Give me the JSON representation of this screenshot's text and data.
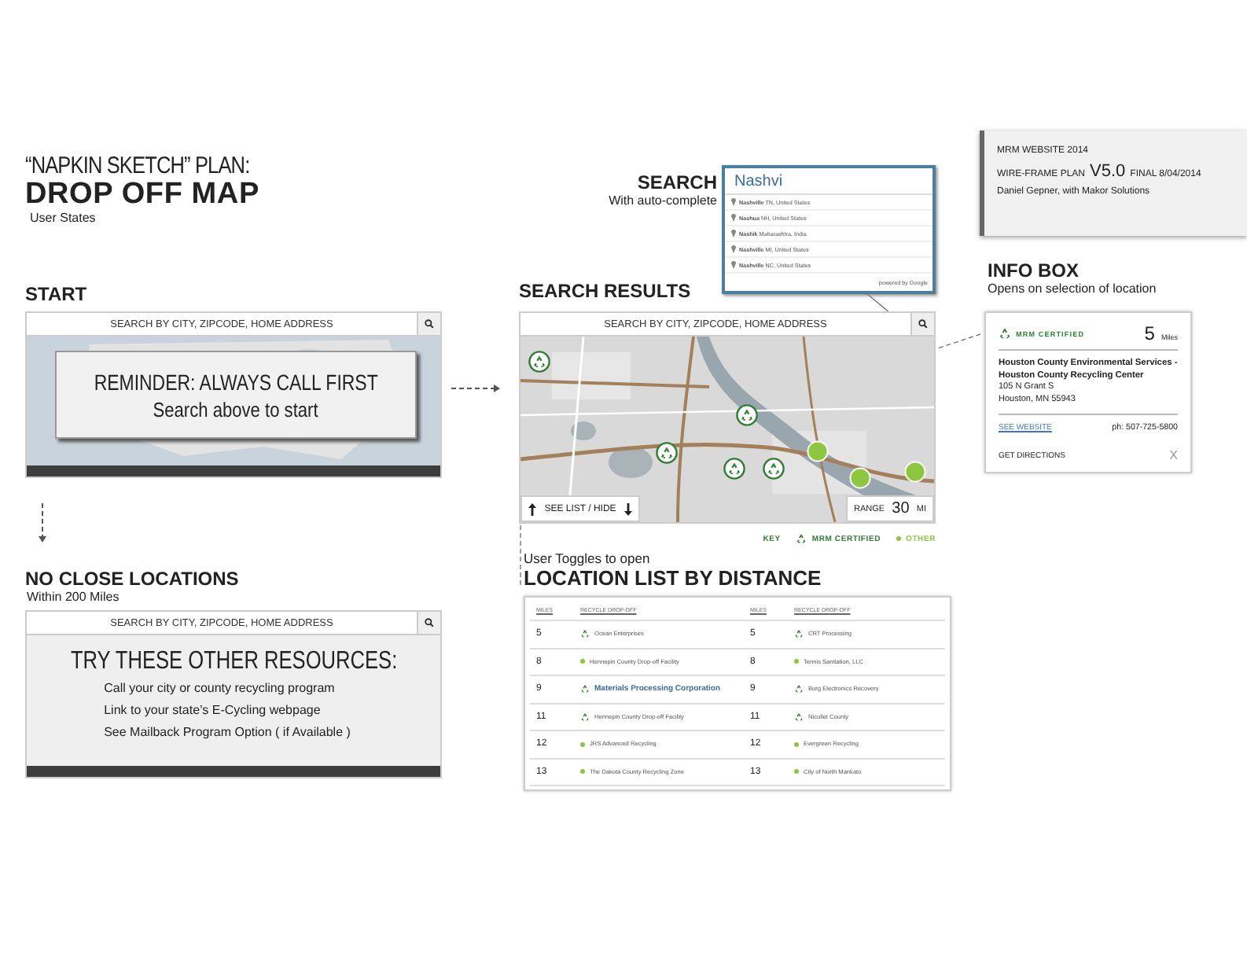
{
  "header": {
    "overline": "“NAPKIN SKETCH” PLAN:",
    "title": "DROP OFF MAP",
    "subtitle": "User States"
  },
  "version_box": {
    "line_1": "MRM WEBSITE 2014",
    "plan_label": "WIRE-FRAME PLAN",
    "version": "V5.0",
    "final": "FINAL 8/04/2014",
    "author": "Daniel Gepner, with Makor Solutions"
  },
  "start": {
    "heading": "START",
    "search_placeholder": "SEARCH BY CITY, ZIPCODE, HOME ADDRESS",
    "reminder_title": "REMINDER: ALWAYS CALL FIRST",
    "reminder_text": "Search above to start"
  },
  "no_close": {
    "heading": "NO CLOSE LOCATIONS",
    "subheading": "Within 200 Miles",
    "search_placeholder": "SEARCH BY CITY, ZIPCODE, HOME ADDRESS",
    "resources_title": "TRY THESE OTHER RESOURCES:",
    "resources": [
      "Call your city or county recycling program",
      "Link to your state’s E-Cycling webpage",
      "See Mailback Program Option ( if Available )"
    ]
  },
  "search": {
    "heading": "SEARCH",
    "subheading": "With auto-complete",
    "query": "Nashvi",
    "suggestions": [
      {
        "place": "Nashville",
        "region": "TN, United States"
      },
      {
        "place": "Nashua",
        "region": "NH, United States"
      },
      {
        "place": "Nashik",
        "region": "Maharashtra, India"
      },
      {
        "place": "Nashville",
        "region": "MI, United States"
      },
      {
        "place": "Nashville",
        "region": "NC, United States"
      }
    ],
    "attribution": "powered by Google"
  },
  "results": {
    "heading": "SEARCH RESULTS",
    "search_placeholder": "SEARCH BY CITY, ZIPCODE, HOME ADDRESS",
    "pins": [
      {
        "kind": "certified"
      },
      {
        "kind": "certified"
      },
      {
        "kind": "certified"
      },
      {
        "kind": "certified"
      },
      {
        "kind": "certified"
      },
      {
        "kind": "other"
      },
      {
        "kind": "other"
      },
      {
        "kind": "other"
      }
    ],
    "list_toggle": "SEE LIST / HIDE",
    "range_label": "RANGE",
    "range_value": "30",
    "range_unit": "MI",
    "key_label": "KEY",
    "key_certified": "MRM CERTIFIED",
    "key_other": "OTHER"
  },
  "info_box": {
    "heading": "INFO BOX",
    "subheading": "Opens on selection of location",
    "badge": "MRM CERTIFIED",
    "distance": "5",
    "distance_unit": "Miles",
    "name": "Houston County Environmental Services - Houston County Recycling Center",
    "address_1": "105 N Grant S",
    "address_2": "Houston, MN 55943",
    "website_link": "SEE WEBSITE",
    "phone": "ph: 507-725-5800",
    "directions": "GET DIRECTIONS",
    "close": "X"
  },
  "location_list": {
    "caption": "User Toggles to open",
    "heading": "LOCATION LIST BY DISTANCE",
    "columns": [
      "MILES",
      "RECYCLE DROP-OFF",
      "MILES",
      "RECYCLE DROP-OFF"
    ],
    "rows": [
      {
        "cells": [
          {
            "kind": "miles",
            "text": "5"
          },
          {
            "kind": "certified",
            "text": "Ocean Enterprises",
            "selected": false
          },
          {
            "kind": "miles",
            "text": "5"
          },
          {
            "kind": "certified",
            "text": "CRT Processing",
            "selected": false
          }
        ]
      },
      {
        "cells": [
          {
            "kind": "miles",
            "text": "8"
          },
          {
            "kind": "other",
            "text": "Hennepin County Drop-off Facility",
            "selected": false
          },
          {
            "kind": "miles",
            "text": "8"
          },
          {
            "kind": "other",
            "text": "Tennis Sanitation, LLC",
            "selected": false
          }
        ]
      },
      {
        "cells": [
          {
            "kind": "miles",
            "text": "9"
          },
          {
            "kind": "certified",
            "text": "Materials Processing Corporation",
            "selected": true
          },
          {
            "kind": "miles",
            "text": "9"
          },
          {
            "kind": "certified",
            "text": "Burg Electronics Recovery",
            "selected": false
          }
        ]
      },
      {
        "cells": [
          {
            "kind": "miles",
            "text": "11"
          },
          {
            "kind": "certified",
            "text": "Hennepin County Drop-off Facility",
            "selected": false
          },
          {
            "kind": "miles",
            "text": "11"
          },
          {
            "kind": "certified",
            "text": "Nicollet County",
            "selected": false
          }
        ]
      },
      {
        "cells": [
          {
            "kind": "miles",
            "text": "12"
          },
          {
            "kind": "other",
            "text": "JRS Advanced Recycling",
            "selected": false
          },
          {
            "kind": "miles",
            "text": "12"
          },
          {
            "kind": "other",
            "text": "Evergreen Recycling",
            "selected": false
          }
        ]
      },
      {
        "cells": [
          {
            "kind": "miles",
            "text": "13"
          },
          {
            "kind": "other",
            "text": "The Dakota County Recycling Zone",
            "selected": false
          },
          {
            "kind": "miles",
            "text": "13"
          },
          {
            "kind": "other",
            "text": "City of North Mankato",
            "selected": false
          }
        ]
      }
    ]
  }
}
